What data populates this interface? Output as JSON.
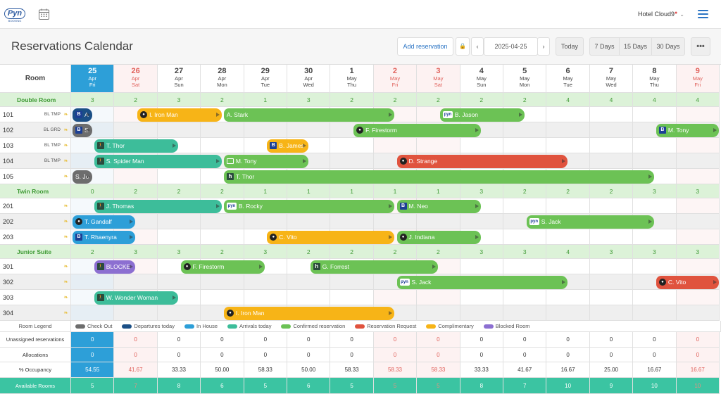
{
  "brand": {
    "logo_text": "Pyn",
    "logo_sub": "BOOKING"
  },
  "header": {
    "hotel_name": "Hotel Cloud9",
    "hotel_dot": "●",
    "hotel_chev": "⌄"
  },
  "toolbar": {
    "title": "Reservations Calendar",
    "add_label": "Add reservation",
    "lock_glyph": "🔒",
    "prev_glyph": "‹",
    "date_value": "2025-04-25",
    "next_glyph": "›",
    "today_label": "Today",
    "views": [
      "7 Days",
      "15 Days",
      "30 Days"
    ],
    "more_glyph": "•••"
  },
  "room_header": "Room",
  "days": [
    {
      "num": "25",
      "mon": "Apr",
      "dow": "Fri",
      "weekend": true,
      "today": true
    },
    {
      "num": "26",
      "mon": "Apr",
      "dow": "Sat",
      "weekend": true,
      "today": false
    },
    {
      "num": "27",
      "mon": "Apr",
      "dow": "Sun",
      "weekend": false,
      "today": false
    },
    {
      "num": "28",
      "mon": "Apr",
      "dow": "Mon",
      "weekend": false,
      "today": false
    },
    {
      "num": "29",
      "mon": "Apr",
      "dow": "Tue",
      "weekend": false,
      "today": false
    },
    {
      "num": "30",
      "mon": "Apr",
      "dow": "Wed",
      "weekend": false,
      "today": false
    },
    {
      "num": "1",
      "mon": "May",
      "dow": "Thu",
      "weekend": false,
      "today": false
    },
    {
      "num": "2",
      "mon": "May",
      "dow": "Fri",
      "weekend": true,
      "today": false
    },
    {
      "num": "3",
      "mon": "May",
      "dow": "Sat",
      "weekend": true,
      "today": false
    },
    {
      "num": "4",
      "mon": "May",
      "dow": "Sun",
      "weekend": false,
      "today": false
    },
    {
      "num": "5",
      "mon": "May",
      "dow": "Mon",
      "weekend": false,
      "today": false
    },
    {
      "num": "6",
      "mon": "May",
      "dow": "Tue",
      "weekend": false,
      "today": false
    },
    {
      "num": "7",
      "mon": "May",
      "dow": "Wed",
      "weekend": false,
      "today": false
    },
    {
      "num": "8",
      "mon": "May",
      "dow": "Thu",
      "weekend": false,
      "today": false
    },
    {
      "num": "9",
      "mon": "May",
      "dow": "Fri",
      "weekend": true,
      "today": false
    }
  ],
  "groups": [
    {
      "name": "Double Room",
      "counts": [
        "3",
        "2",
        "3",
        "2",
        "1",
        "3",
        "2",
        "2",
        "2",
        "2",
        "2",
        "4",
        "4",
        "4",
        "4"
      ],
      "rooms": [
        {
          "num": "101",
          "tags": "BL TMP"
        },
        {
          "num": "102",
          "tags": "BL GRD"
        },
        {
          "num": "103",
          "tags": "BL TMP"
        },
        {
          "num": "104",
          "tags": "BL TMP"
        },
        {
          "num": "105",
          "tags": ""
        }
      ]
    },
    {
      "name": "Twin Room",
      "counts": [
        "0",
        "2",
        "2",
        "2",
        "1",
        "1",
        "1",
        "1",
        "1",
        "3",
        "2",
        "2",
        "2",
        "3",
        "3"
      ],
      "rooms": [
        {
          "num": "201",
          "tags": ""
        },
        {
          "num": "202",
          "tags": ""
        },
        {
          "num": "203",
          "tags": ""
        }
      ]
    },
    {
      "name": "Junior Suite",
      "counts": [
        "2",
        "3",
        "3",
        "2",
        "3",
        "2",
        "2",
        "2",
        "2",
        "3",
        "3",
        "4",
        "3",
        "3",
        "3"
      ],
      "rooms": [
        {
          "num": "301",
          "tags": ""
        },
        {
          "num": "302",
          "tags": ""
        },
        {
          "num": "303",
          "tags": ""
        },
        {
          "num": "304",
          "tags": ""
        }
      ]
    }
  ],
  "reservations": [
    {
      "room": "101",
      "start": 0,
      "end": 0.5,
      "status": "departure",
      "icon": "b",
      "label": "A"
    },
    {
      "room": "101",
      "start": 1.5,
      "end": 3.5,
      "status": "complimentary",
      "icon": "dot",
      "label": "I. Iron Man"
    },
    {
      "room": "101",
      "start": 3.5,
      "end": 7.5,
      "status": "confirmed",
      "icon": "none",
      "label": "A. Stark"
    },
    {
      "room": "101",
      "start": 8.5,
      "end": 10.5,
      "status": "confirmed",
      "icon": "pyn",
      "label": "B. Jason"
    },
    {
      "room": "102",
      "start": 0,
      "end": 0.5,
      "status": "checkout",
      "icon": "b",
      "label": "S"
    },
    {
      "room": "102",
      "start": 6.5,
      "end": 9.5,
      "status": "confirmed",
      "icon": "dot",
      "label": "F. Firestorm"
    },
    {
      "room": "102",
      "start": 13.5,
      "end": 15,
      "status": "confirmed",
      "icon": "b",
      "label": "M. Tony"
    },
    {
      "room": "103",
      "start": 0.5,
      "end": 2.5,
      "status": "arrival",
      "icon": "walk",
      "label": "T. Thor"
    },
    {
      "room": "103",
      "start": 4.5,
      "end": 5.5,
      "status": "complimentary",
      "icon": "b",
      "label": "B. James"
    },
    {
      "room": "104",
      "start": 0.5,
      "end": 3.5,
      "status": "arrival",
      "icon": "walk",
      "label": "S. Spider Man"
    },
    {
      "room": "104",
      "start": 3.5,
      "end": 5.5,
      "status": "confirmed",
      "icon": "env",
      "label": "M. Tony"
    },
    {
      "room": "104",
      "start": 7.5,
      "end": 11.5,
      "status": "request",
      "icon": "dot",
      "label": "D. Strange"
    },
    {
      "room": "105",
      "start": 0,
      "end": 0.5,
      "status": "checkout",
      "icon": "none",
      "label": "S. Jo"
    },
    {
      "room": "105",
      "start": 3.5,
      "end": 13.5,
      "status": "confirmed",
      "icon": "h",
      "label": "T. Thor"
    },
    {
      "room": "201",
      "start": 0.5,
      "end": 3.5,
      "status": "arrival",
      "icon": "walk",
      "label": "J. Thomas"
    },
    {
      "room": "201",
      "start": 3.5,
      "end": 7.5,
      "status": "confirmed",
      "icon": "pyn",
      "label": "B. Rocky"
    },
    {
      "room": "201",
      "start": 7.5,
      "end": 9.5,
      "status": "confirmed",
      "icon": "b",
      "label": "M. Neo"
    },
    {
      "room": "202",
      "start": 0,
      "end": 1.5,
      "status": "inhouse",
      "icon": "dot",
      "label": "T. Gandalf"
    },
    {
      "room": "202",
      "start": 10.5,
      "end": 13.5,
      "status": "confirmed",
      "icon": "pyn",
      "label": "S. Jack"
    },
    {
      "room": "203",
      "start": 0,
      "end": 1.5,
      "status": "inhouse",
      "icon": "b",
      "label": "T. Rhaenyra"
    },
    {
      "room": "203",
      "start": 4.5,
      "end": 7.5,
      "status": "complimentary",
      "icon": "dot",
      "label": "C. Vito"
    },
    {
      "room": "203",
      "start": 7.5,
      "end": 9.5,
      "status": "confirmed",
      "icon": "dot",
      "label": "J. Indiana"
    },
    {
      "room": "301",
      "start": 0.5,
      "end": 1.5,
      "status": "blocked",
      "icon": "walk",
      "label": "BLOCKE"
    },
    {
      "room": "301",
      "start": 2.5,
      "end": 4.5,
      "status": "confirmed",
      "icon": "dot",
      "label": "F. Firestorm"
    },
    {
      "room": "301",
      "start": 5.5,
      "end": 8.5,
      "status": "confirmed",
      "icon": "h",
      "label": "G. Forrest"
    },
    {
      "room": "302",
      "start": 7.5,
      "end": 11.5,
      "status": "confirmed",
      "icon": "pyn",
      "label": "S. Jack"
    },
    {
      "room": "302",
      "start": 13.5,
      "end": 15,
      "status": "request",
      "icon": "dot",
      "label": "C. Vito"
    },
    {
      "room": "303",
      "start": 0.5,
      "end": 2.5,
      "status": "arrival",
      "icon": "walk",
      "label": "W. Wonder Woman"
    },
    {
      "room": "304",
      "start": 3.5,
      "end": 7.5,
      "status": "complimentary",
      "icon": "dot",
      "label": "I. Iron Man"
    }
  ],
  "status_colors": {
    "checkout": "#6d6d6d",
    "departure": "#1b4f86",
    "inhouse": "#2d9fd8",
    "arrival": "#3dbd9a",
    "confirmed": "#6cc255",
    "request": "#e0533e",
    "complimentary": "#f7b417",
    "blocked": "#8c6fd1"
  },
  "legend": {
    "title": "Room Legend",
    "items": [
      {
        "label": "Check Out",
        "color": "#6d6d6d"
      },
      {
        "label": "Departures today",
        "color": "#1b4f86"
      },
      {
        "label": "In House",
        "color": "#2d9fd8"
      },
      {
        "label": "Arrivals today",
        "color": "#3dbd9a"
      },
      {
        "label": "Confirmed reservation",
        "color": "#6cc255"
      },
      {
        "label": "Reservation Request",
        "color": "#e0533e"
      },
      {
        "label": "Complimentary",
        "color": "#f7b417"
      },
      {
        "label": "Blocked Room",
        "color": "#8c6fd1"
      }
    ]
  },
  "stats": [
    {
      "label": "Unassigned reservations",
      "values": [
        "0",
        "0",
        "0",
        "0",
        "0",
        "0",
        "0",
        "0",
        "0",
        "0",
        "0",
        "0",
        "0",
        "0",
        "0"
      ]
    },
    {
      "label": "Allocations",
      "values": [
        "0",
        "0",
        "0",
        "0",
        "0",
        "0",
        "0",
        "0",
        "0",
        "0",
        "0",
        "0",
        "0",
        "0",
        "0"
      ]
    },
    {
      "label": "% Occupancy",
      "values": [
        "54.55",
        "41.67",
        "33.33",
        "50.00",
        "58.33",
        "50.00",
        "58.33",
        "58.33",
        "58.33",
        "33.33",
        "41.67",
        "16.67",
        "25.00",
        "16.67",
        "16.67"
      ]
    }
  ],
  "available": {
    "label": "Available Rooms",
    "values": [
      "5",
      "7",
      "8",
      "6",
      "5",
      "6",
      "5",
      "5",
      "5",
      "8",
      "7",
      "10",
      "9",
      "10",
      "10"
    ]
  }
}
